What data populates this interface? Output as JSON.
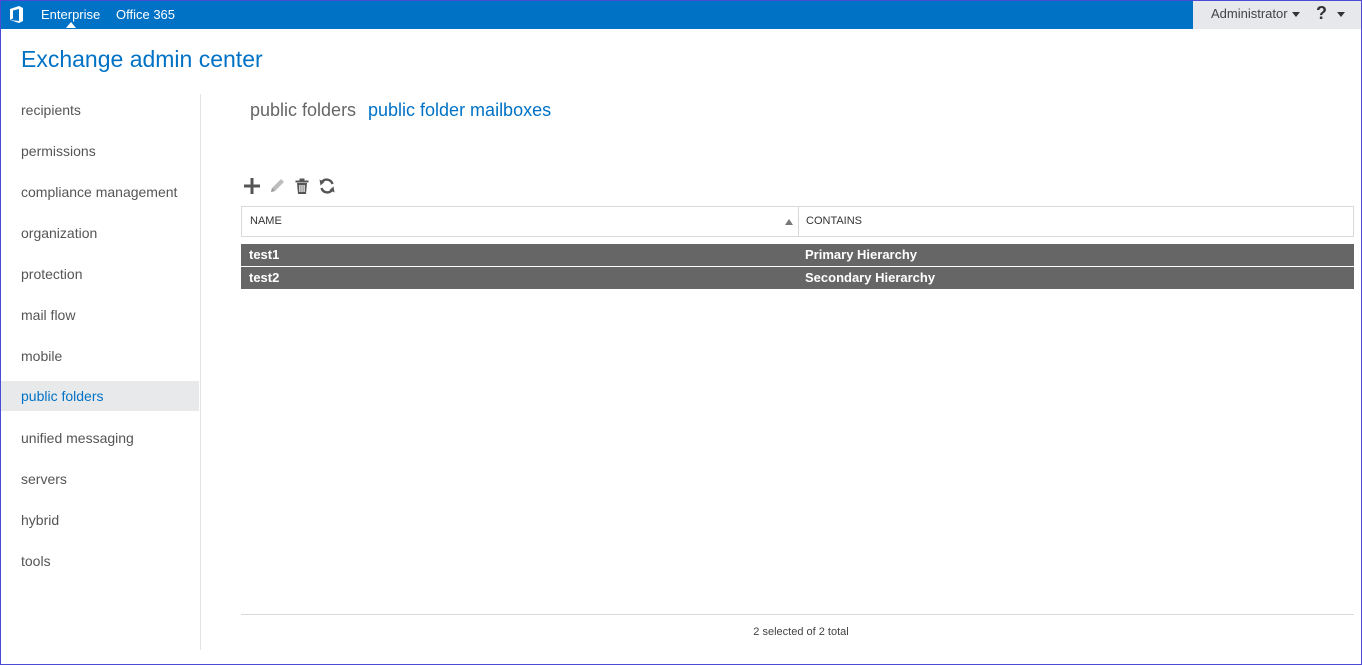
{
  "topbar": {
    "links": [
      "Enterprise",
      "Office 365"
    ],
    "user": "Administrator",
    "help": "?",
    "brand_color": "#0072c6"
  },
  "app": {
    "title": "Exchange admin center"
  },
  "sidebar": {
    "items": [
      {
        "label": "recipients"
      },
      {
        "label": "permissions"
      },
      {
        "label": "compliance management"
      },
      {
        "label": "organization"
      },
      {
        "label": "protection"
      },
      {
        "label": "mail flow"
      },
      {
        "label": "mobile"
      },
      {
        "label": "public folders",
        "active": true
      },
      {
        "label": "unified messaging"
      },
      {
        "label": "servers"
      },
      {
        "label": "hybrid"
      },
      {
        "label": "tools"
      }
    ]
  },
  "tabs": [
    {
      "label": "public folders"
    },
    {
      "label": "public folder mailboxes",
      "active": true
    }
  ],
  "toolbar": {
    "icons": [
      "add-icon",
      "edit-icon",
      "delete-icon",
      "refresh-icon"
    ]
  },
  "grid": {
    "columns": [
      "NAME",
      "CONTAINS"
    ],
    "rows": [
      {
        "name": "test1",
        "contains": "Primary Hierarchy"
      },
      {
        "name": "test2",
        "contains": "Secondary Hierarchy"
      }
    ],
    "selected_row_color": "#666666"
  },
  "status": {
    "text": "2 selected of 2 total"
  }
}
